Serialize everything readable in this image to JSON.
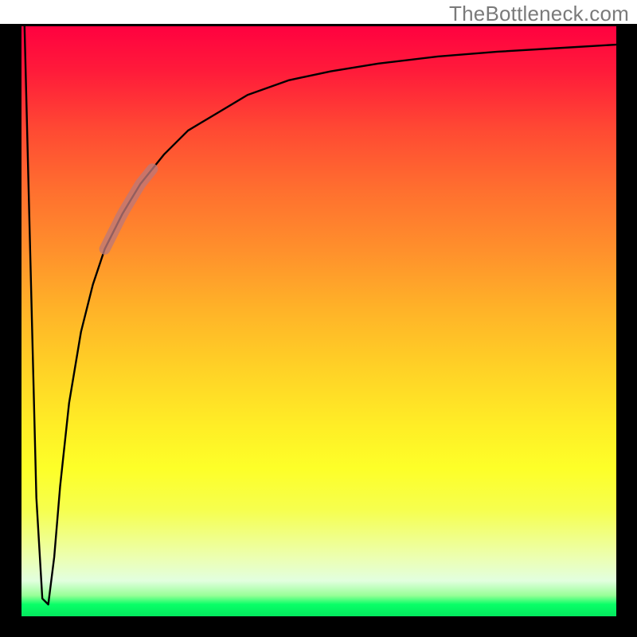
{
  "watermark": "TheBottleneck.com",
  "chart_data": {
    "type": "line",
    "title": "",
    "xlabel": "",
    "ylabel": "",
    "xlim": [
      0,
      100
    ],
    "ylim": [
      0,
      100
    ],
    "grid": false,
    "series": [
      {
        "name": "bottleneck-curve",
        "x": [
          0.5,
          1.5,
          2.5,
          3.5,
          4.5,
          5.5,
          6.5,
          8,
          10,
          12,
          14,
          17,
          20,
          24,
          28,
          33,
          38,
          45,
          52,
          60,
          70,
          80,
          90,
          100
        ],
        "values": [
          100,
          60,
          20,
          3,
          2,
          10,
          22,
          36,
          48,
          56,
          62,
          68,
          73,
          78,
          82,
          85,
          88,
          90.5,
          92,
          93.3,
          94.5,
          95.3,
          95.9,
          96.5
        ]
      }
    ],
    "annotations": [
      {
        "name": "highlight-segment",
        "type": "stroke-overlay",
        "color_rgba": "rgba(188,120,120,0.78)",
        "x_range": [
          14,
          22
        ],
        "y_range": [
          62,
          76
        ]
      }
    ]
  }
}
